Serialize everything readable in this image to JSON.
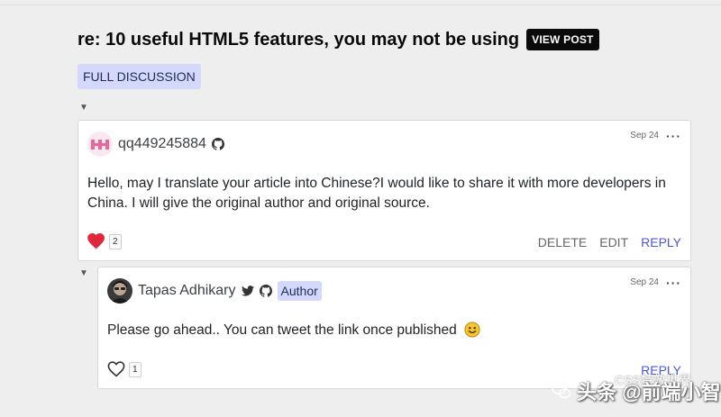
{
  "post": {
    "title": "re: 10 useful HTML5 features, you may not be using",
    "view_post_label": "VIEW POST",
    "full_discussion_label": "FULL DISCUSSION"
  },
  "comments": [
    {
      "username": "qq449245884",
      "date": "Sep 24",
      "body": "Hello, may I translate your article into Chinese?I would like to share it with more developers in China. I will give the original author and original source.",
      "likes": "2",
      "actions": {
        "delete": "DELETE",
        "edit": "EDIT",
        "reply": "REPLY"
      },
      "liked": true,
      "icons": [
        "github-icon"
      ]
    },
    {
      "username": "Tapas Adhikary",
      "badge": "Author",
      "date": "Sep 24",
      "body": "Please go ahead.. You can tweet the link once published",
      "likes": "1",
      "actions": {
        "reply": "REPLY"
      },
      "liked": false,
      "icons": [
        "twitter-icon",
        "github-icon"
      ]
    }
  ],
  "watermark": {
    "main": "头条 @前端小智",
    "sub": "CSS特效世界"
  },
  "colors": {
    "accent": "#4b57d6",
    "badge_bg": "#d4d9fb",
    "heart": "#e0283c"
  }
}
